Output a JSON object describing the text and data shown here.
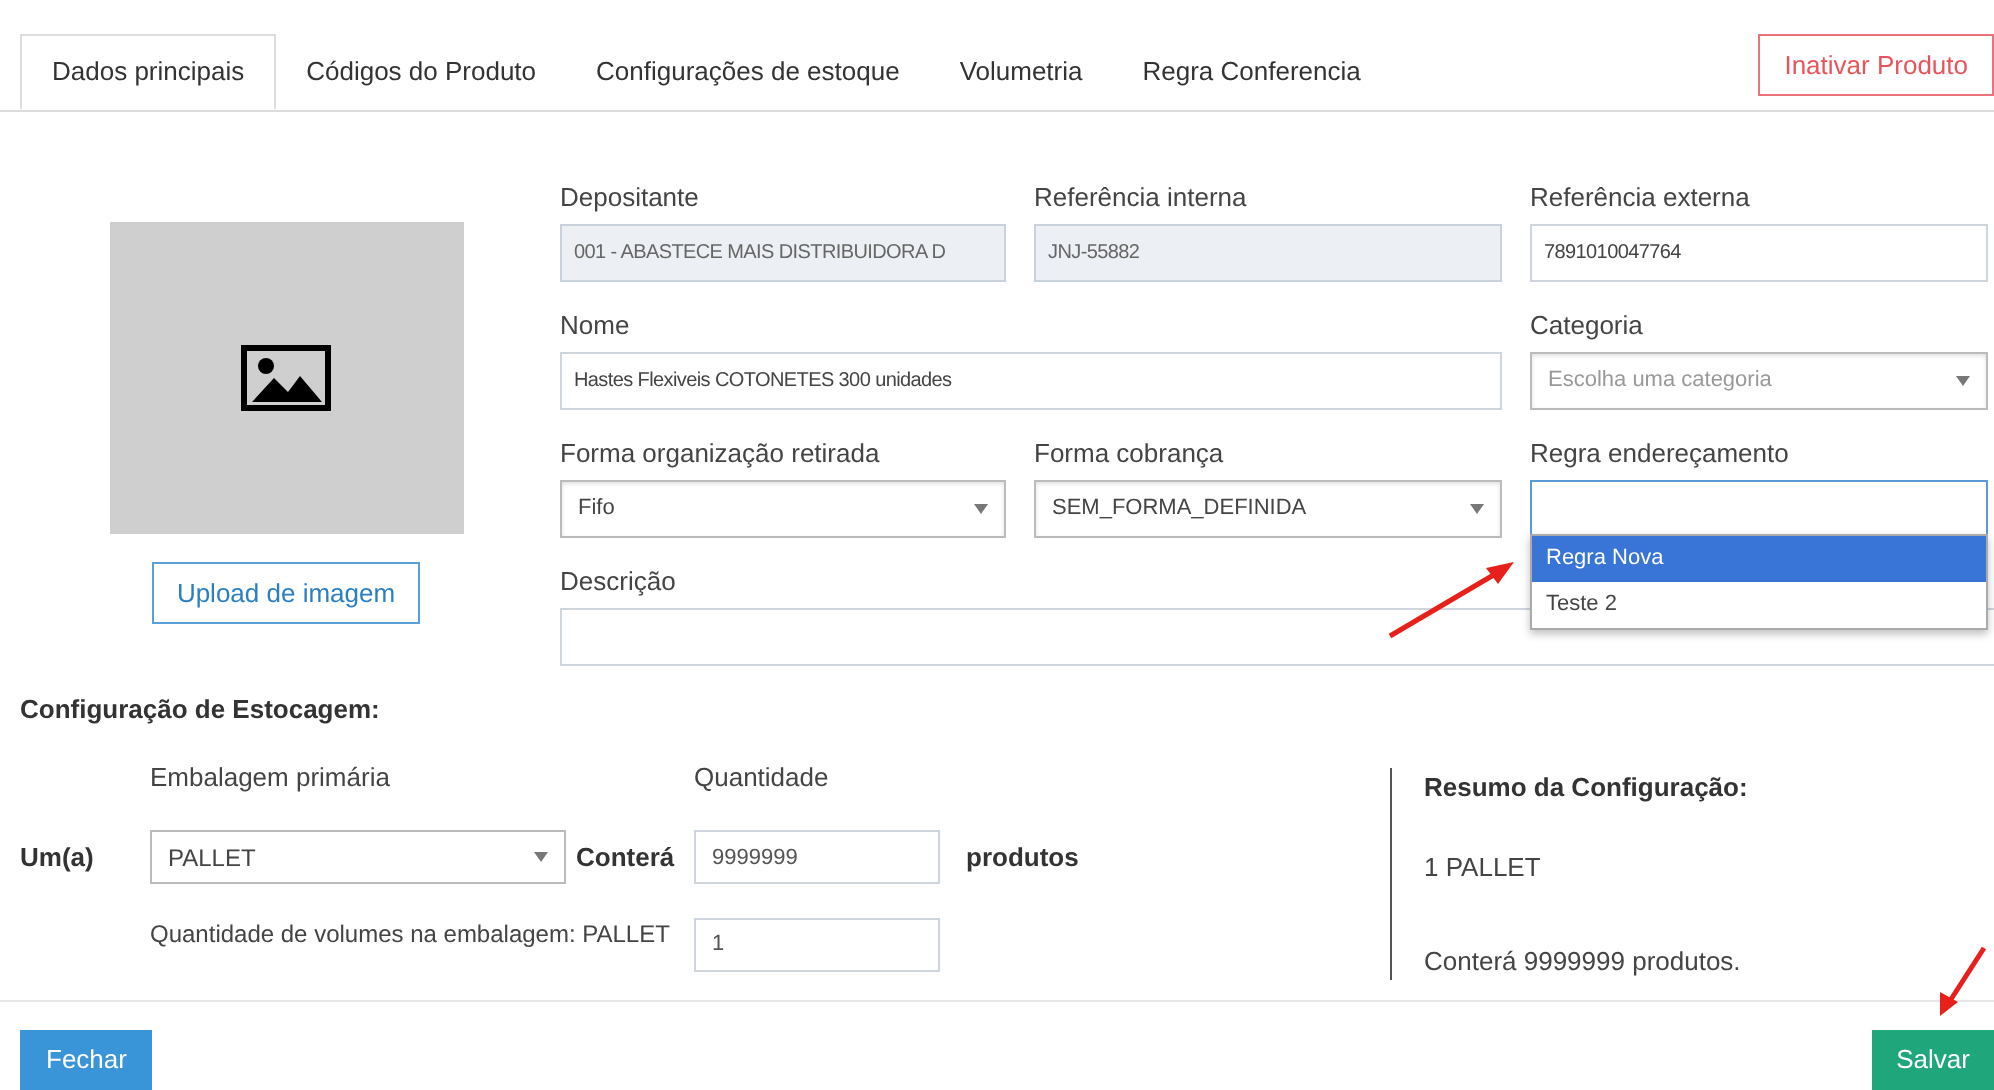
{
  "tabs": [
    {
      "label": "Dados principais",
      "selected": true
    },
    {
      "label": "Códigos do Produto",
      "selected": false
    },
    {
      "label": "Configurações de estoque",
      "selected": false
    },
    {
      "label": "Volumetria",
      "selected": false
    },
    {
      "label": "Regra Conferencia",
      "selected": false
    }
  ],
  "inactivate_button": "Inativar Produto",
  "upload_button": "Upload de imagem",
  "form_rows": [
    [
      {
        "label": "Depositante",
        "kind": "input",
        "value": "001 - ABASTECE MAIS DISTRIBUIDORA D",
        "disabled": true
      },
      {
        "label": "Referência interna",
        "kind": "input",
        "value": "JNJ-55882",
        "disabled": true
      },
      {
        "label": "Referência externa",
        "kind": "input",
        "value": "7891010047764",
        "disabled": false
      }
    ],
    [
      {
        "label": "Nome",
        "kind": "input",
        "value": "Hastes Flexiveis COTONETES 300 unidades",
        "disabled": false
      },
      {
        "label": "Categoria",
        "kind": "select",
        "placeholder": "Escolha uma categoria"
      }
    ],
    [
      {
        "label": "Forma organização retirada",
        "kind": "select",
        "value": "Fifo"
      },
      {
        "label": "Forma cobrança",
        "kind": "select",
        "value": "SEM_FORMA_DEFINIDA"
      },
      {
        "label": "Regra endereçamento",
        "kind": "combobox",
        "focused": true,
        "expanded": true,
        "options": [
          {
            "label": "Regra Nova",
            "selected": true
          },
          {
            "label": "Teste 2",
            "selected": false
          }
        ]
      }
    ],
    [
      {
        "label": "Descrição",
        "kind": "textarea"
      }
    ]
  ],
  "storage": {
    "title": "Configuração de Estocagem:",
    "unit_label": "Um(a)",
    "packaging": {
      "label": "Embalagem primária",
      "value": "PALLET"
    },
    "contains_label": "Conterá",
    "quantity": {
      "label": "Quantidade",
      "value": "9999999"
    },
    "products_label": "produtos",
    "volumes": {
      "label": "Quantidade de volumes na embalagem: PALLET",
      "value": "1"
    }
  },
  "summary": {
    "title": "Resumo da Configuração:",
    "lines": [
      "1 PALLET",
      "Conterá 9999999 produtos."
    ]
  },
  "close_button": "Fechar",
  "save_button": "Salvar"
}
